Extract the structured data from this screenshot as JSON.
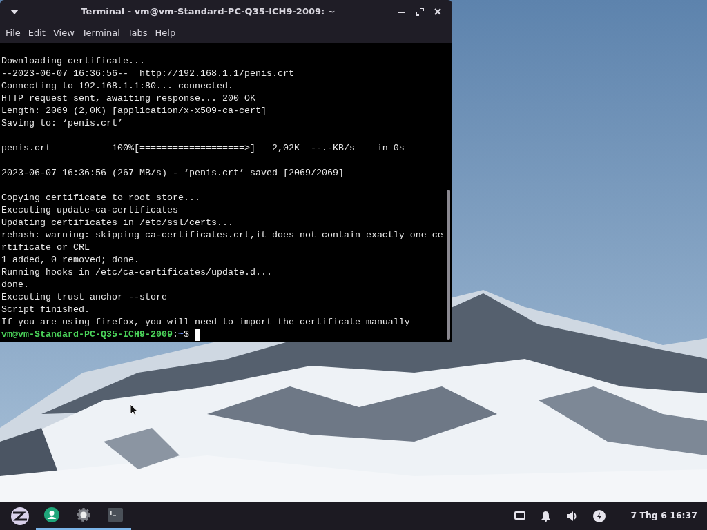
{
  "window": {
    "title": "Terminal - vm@vm-Standard-PC-Q35-ICH9-2009: ~"
  },
  "menu": [
    "File",
    "Edit",
    "View",
    "Terminal",
    "Tabs",
    "Help"
  ],
  "terminal": {
    "blocks": [
      {
        "lines": [
          "Downloading certificate...",
          "--2023-06-07 16:36:56--  http://192.168.1.1/penis.crt",
          "Connecting to 192.168.1.1:80... connected.",
          "HTTP request sent, awaiting response... 200 OK",
          "Length: 2069 (2,0K) [application/x-x509-ca-cert]",
          "Saving to: ‘penis.crt’"
        ]
      },
      {
        "lines": [
          "penis.crt           100%[===================>]   2,02K  --.-KB/s    in 0s"
        ]
      },
      {
        "lines": [
          "2023-06-07 16:36:56 (267 MB/s) - ‘penis.crt’ saved [2069/2069]"
        ]
      },
      {
        "lines": [
          "Copying certificate to root store...",
          "Executing update-ca-certificates",
          "Updating certificates in /etc/ssl/certs...",
          "rehash: warning: skipping ca-certificates.crt,it does not contain exactly one ce",
          "rtificate or CRL",
          "1 added, 0 removed; done.",
          "Running hooks in /etc/ca-certificates/update.d...",
          "done.",
          "Executing trust anchor --store",
          "Script finished.",
          "If you are using firefox, you will need to import the certificate manually"
        ]
      }
    ],
    "prompt": {
      "user_host": "vm@vm-Standard-PC-Q35-ICH9-2009",
      "separator": ":",
      "path": "~",
      "symbol": "$"
    }
  },
  "taskbar": {
    "apps": [
      {
        "kind": "user",
        "running": true
      },
      {
        "kind": "settings",
        "running": true
      },
      {
        "kind": "terminal",
        "running": true
      }
    ],
    "clock": "7 Thg 6 16:37"
  }
}
